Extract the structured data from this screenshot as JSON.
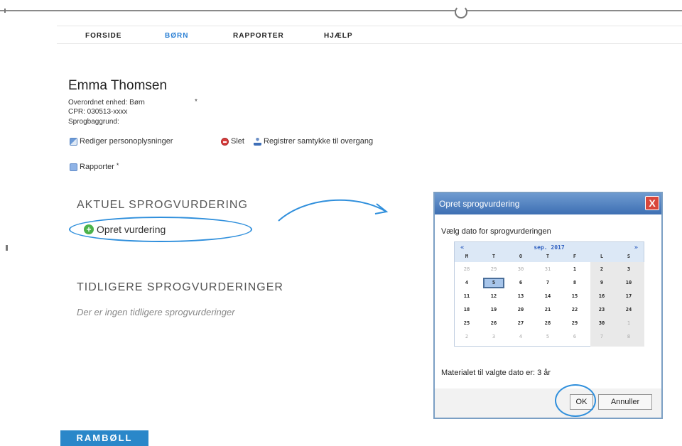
{
  "nav": {
    "items": [
      "FORSIDE",
      "BØRN",
      "RAPPORTER",
      "HJÆLP"
    ],
    "active": "BØRN"
  },
  "person": {
    "name": "Emma Thomsen",
    "unit": "Overordnet enhed: Børn",
    "cpr": "CPR: 030513-xxxx",
    "language_background": "Sprogbaggrund:"
  },
  "actions": {
    "edit": "Rediger personoplysninger",
    "delete": "Slet",
    "consent": "Registrer samtykke til overgang",
    "reports": "Rapporter"
  },
  "current": {
    "title": "AKTUEL SPROGVURDERING",
    "create": "Opret vurdering"
  },
  "previous": {
    "title": "TIDLIGERE SPROGVURDERINGER",
    "empty": "Der er ingen tidligere sprogvurderinger"
  },
  "dialog": {
    "title": "Opret sprogvurdering",
    "close": "X",
    "prompt": "Vælg dato for sprogvurderingen",
    "note": "Materialet til valgte dato er: 3 år",
    "ok": "OK",
    "cancel": "Annuller"
  },
  "calendar": {
    "prev": "«",
    "next": "»",
    "month": "sep. 2017",
    "weekdays": [
      "M",
      "T",
      "O",
      "T",
      "F",
      "L",
      "S"
    ],
    "weeks": [
      [
        "28",
        "29",
        "30",
        "31",
        "1",
        "2",
        "3"
      ],
      [
        "4",
        "5",
        "6",
        "7",
        "8",
        "9",
        "10"
      ],
      [
        "11",
        "12",
        "13",
        "14",
        "15",
        "16",
        "17"
      ],
      [
        "18",
        "19",
        "20",
        "21",
        "22",
        "23",
        "24"
      ],
      [
        "25",
        "26",
        "27",
        "28",
        "29",
        "30",
        "1"
      ],
      [
        "2",
        "3",
        "4",
        "5",
        "6",
        "7",
        "8"
      ]
    ],
    "selected": "5"
  },
  "logo": "RAMBØLL",
  "colors": {
    "accent": "#2a7fd4",
    "dialog_header": "#3d6fb3",
    "annotation": "#2f8fdc"
  }
}
